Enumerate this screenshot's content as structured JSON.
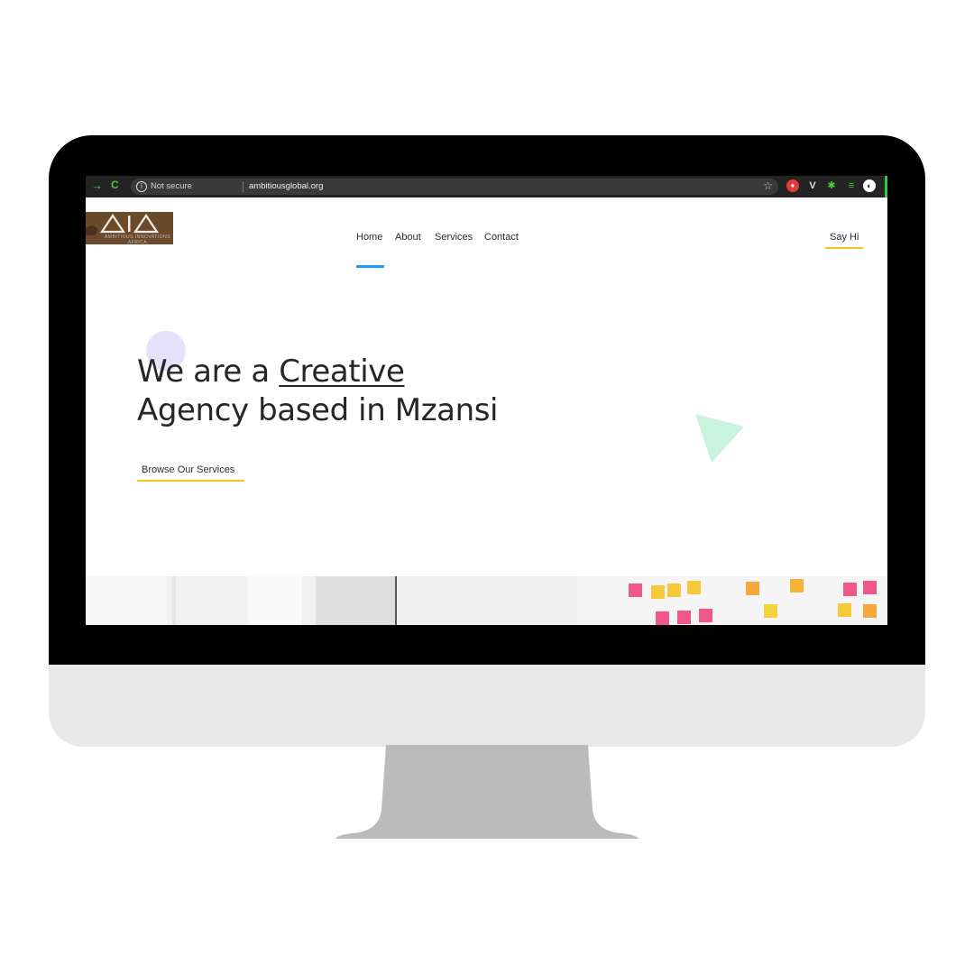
{
  "browser": {
    "security_label": "Not secure",
    "url": "ambitiousglobal.org",
    "icons": [
      "back-arrow-icon",
      "reload-icon",
      "info-icon",
      "star-icon",
      "red-extension-icon",
      "v-extension-icon",
      "puzzle-icon",
      "playlist-icon",
      "avatar-icon"
    ]
  },
  "site": {
    "logo_letters": "AIA",
    "logo_subtitle": "AMBITIOUS INNOVATIONS AFRICA",
    "nav": [
      "Home",
      "About",
      "Services",
      "Contact"
    ],
    "active_nav": "Home",
    "cta": "Say Hi"
  },
  "hero": {
    "line1_prefix": "We are a ",
    "line1_emphasis": "Creative",
    "line2": "Agency based in Mzansi",
    "button": "Browse Our Services"
  },
  "colors": {
    "accent_yellow": "#f7c51c",
    "accent_blue": "#1f9bff",
    "shape_purple": "#e6e1fb",
    "shape_green": "#c8f3df",
    "chrome_green": "#3fd23f"
  }
}
